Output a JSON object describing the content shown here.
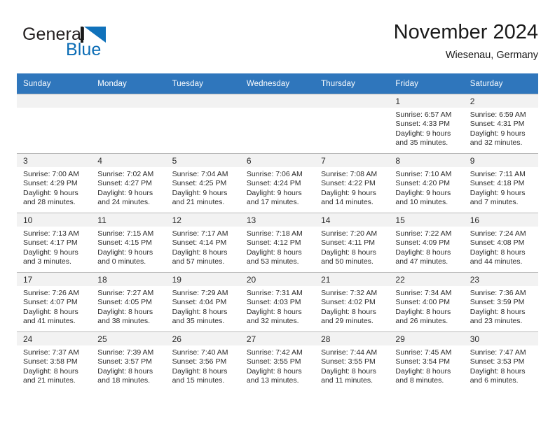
{
  "brand": {
    "word_one": "General",
    "word_two": "Blue",
    "mark_icon": "triangle-flag-icon",
    "accent_color": "#1072bb"
  },
  "header": {
    "title": "November 2024",
    "subtitle": "Wiesenau, Germany"
  },
  "theme": {
    "header_row_color": "#2f76bc",
    "daynum_band_color": "#f2f2f2",
    "grid_line_color": "#b9b9b9"
  },
  "calendar": {
    "weekday_headers": [
      "Sunday",
      "Monday",
      "Tuesday",
      "Wednesday",
      "Thursday",
      "Friday",
      "Saturday"
    ],
    "weeks": [
      [
        {
          "day": "",
          "empty": true
        },
        {
          "day": "",
          "empty": true
        },
        {
          "day": "",
          "empty": true
        },
        {
          "day": "",
          "empty": true
        },
        {
          "day": "",
          "empty": true
        },
        {
          "day": "1",
          "sunrise": "Sunrise: 6:57 AM",
          "sunset": "Sunset: 4:33 PM",
          "daylight_1": "Daylight: 9 hours",
          "daylight_2": "and 35 minutes."
        },
        {
          "day": "2",
          "sunrise": "Sunrise: 6:59 AM",
          "sunset": "Sunset: 4:31 PM",
          "daylight_1": "Daylight: 9 hours",
          "daylight_2": "and 32 minutes."
        }
      ],
      [
        {
          "day": "3",
          "sunrise": "Sunrise: 7:00 AM",
          "sunset": "Sunset: 4:29 PM",
          "daylight_1": "Daylight: 9 hours",
          "daylight_2": "and 28 minutes."
        },
        {
          "day": "4",
          "sunrise": "Sunrise: 7:02 AM",
          "sunset": "Sunset: 4:27 PM",
          "daylight_1": "Daylight: 9 hours",
          "daylight_2": "and 24 minutes."
        },
        {
          "day": "5",
          "sunrise": "Sunrise: 7:04 AM",
          "sunset": "Sunset: 4:25 PM",
          "daylight_1": "Daylight: 9 hours",
          "daylight_2": "and 21 minutes."
        },
        {
          "day": "6",
          "sunrise": "Sunrise: 7:06 AM",
          "sunset": "Sunset: 4:24 PM",
          "daylight_1": "Daylight: 9 hours",
          "daylight_2": "and 17 minutes."
        },
        {
          "day": "7",
          "sunrise": "Sunrise: 7:08 AM",
          "sunset": "Sunset: 4:22 PM",
          "daylight_1": "Daylight: 9 hours",
          "daylight_2": "and 14 minutes."
        },
        {
          "day": "8",
          "sunrise": "Sunrise: 7:10 AM",
          "sunset": "Sunset: 4:20 PM",
          "daylight_1": "Daylight: 9 hours",
          "daylight_2": "and 10 minutes."
        },
        {
          "day": "9",
          "sunrise": "Sunrise: 7:11 AM",
          "sunset": "Sunset: 4:18 PM",
          "daylight_1": "Daylight: 9 hours",
          "daylight_2": "and 7 minutes."
        }
      ],
      [
        {
          "day": "10",
          "sunrise": "Sunrise: 7:13 AM",
          "sunset": "Sunset: 4:17 PM",
          "daylight_1": "Daylight: 9 hours",
          "daylight_2": "and 3 minutes."
        },
        {
          "day": "11",
          "sunrise": "Sunrise: 7:15 AM",
          "sunset": "Sunset: 4:15 PM",
          "daylight_1": "Daylight: 9 hours",
          "daylight_2": "and 0 minutes."
        },
        {
          "day": "12",
          "sunrise": "Sunrise: 7:17 AM",
          "sunset": "Sunset: 4:14 PM",
          "daylight_1": "Daylight: 8 hours",
          "daylight_2": "and 57 minutes."
        },
        {
          "day": "13",
          "sunrise": "Sunrise: 7:18 AM",
          "sunset": "Sunset: 4:12 PM",
          "daylight_1": "Daylight: 8 hours",
          "daylight_2": "and 53 minutes."
        },
        {
          "day": "14",
          "sunrise": "Sunrise: 7:20 AM",
          "sunset": "Sunset: 4:11 PM",
          "daylight_1": "Daylight: 8 hours",
          "daylight_2": "and 50 minutes."
        },
        {
          "day": "15",
          "sunrise": "Sunrise: 7:22 AM",
          "sunset": "Sunset: 4:09 PM",
          "daylight_1": "Daylight: 8 hours",
          "daylight_2": "and 47 minutes."
        },
        {
          "day": "16",
          "sunrise": "Sunrise: 7:24 AM",
          "sunset": "Sunset: 4:08 PM",
          "daylight_1": "Daylight: 8 hours",
          "daylight_2": "and 44 minutes."
        }
      ],
      [
        {
          "day": "17",
          "sunrise": "Sunrise: 7:26 AM",
          "sunset": "Sunset: 4:07 PM",
          "daylight_1": "Daylight: 8 hours",
          "daylight_2": "and 41 minutes."
        },
        {
          "day": "18",
          "sunrise": "Sunrise: 7:27 AM",
          "sunset": "Sunset: 4:05 PM",
          "daylight_1": "Daylight: 8 hours",
          "daylight_2": "and 38 minutes."
        },
        {
          "day": "19",
          "sunrise": "Sunrise: 7:29 AM",
          "sunset": "Sunset: 4:04 PM",
          "daylight_1": "Daylight: 8 hours",
          "daylight_2": "and 35 minutes."
        },
        {
          "day": "20",
          "sunrise": "Sunrise: 7:31 AM",
          "sunset": "Sunset: 4:03 PM",
          "daylight_1": "Daylight: 8 hours",
          "daylight_2": "and 32 minutes."
        },
        {
          "day": "21",
          "sunrise": "Sunrise: 7:32 AM",
          "sunset": "Sunset: 4:02 PM",
          "daylight_1": "Daylight: 8 hours",
          "daylight_2": "and 29 minutes."
        },
        {
          "day": "22",
          "sunrise": "Sunrise: 7:34 AM",
          "sunset": "Sunset: 4:00 PM",
          "daylight_1": "Daylight: 8 hours",
          "daylight_2": "and 26 minutes."
        },
        {
          "day": "23",
          "sunrise": "Sunrise: 7:36 AM",
          "sunset": "Sunset: 3:59 PM",
          "daylight_1": "Daylight: 8 hours",
          "daylight_2": "and 23 minutes."
        }
      ],
      [
        {
          "day": "24",
          "sunrise": "Sunrise: 7:37 AM",
          "sunset": "Sunset: 3:58 PM",
          "daylight_1": "Daylight: 8 hours",
          "daylight_2": "and 21 minutes."
        },
        {
          "day": "25",
          "sunrise": "Sunrise: 7:39 AM",
          "sunset": "Sunset: 3:57 PM",
          "daylight_1": "Daylight: 8 hours",
          "daylight_2": "and 18 minutes."
        },
        {
          "day": "26",
          "sunrise": "Sunrise: 7:40 AM",
          "sunset": "Sunset: 3:56 PM",
          "daylight_1": "Daylight: 8 hours",
          "daylight_2": "and 15 minutes."
        },
        {
          "day": "27",
          "sunrise": "Sunrise: 7:42 AM",
          "sunset": "Sunset: 3:55 PM",
          "daylight_1": "Daylight: 8 hours",
          "daylight_2": "and 13 minutes."
        },
        {
          "day": "28",
          "sunrise": "Sunrise: 7:44 AM",
          "sunset": "Sunset: 3:55 PM",
          "daylight_1": "Daylight: 8 hours",
          "daylight_2": "and 11 minutes."
        },
        {
          "day": "29",
          "sunrise": "Sunrise: 7:45 AM",
          "sunset": "Sunset: 3:54 PM",
          "daylight_1": "Daylight: 8 hours",
          "daylight_2": "and 8 minutes."
        },
        {
          "day": "30",
          "sunrise": "Sunrise: 7:47 AM",
          "sunset": "Sunset: 3:53 PM",
          "daylight_1": "Daylight: 8 hours",
          "daylight_2": "and 6 minutes."
        }
      ]
    ]
  }
}
